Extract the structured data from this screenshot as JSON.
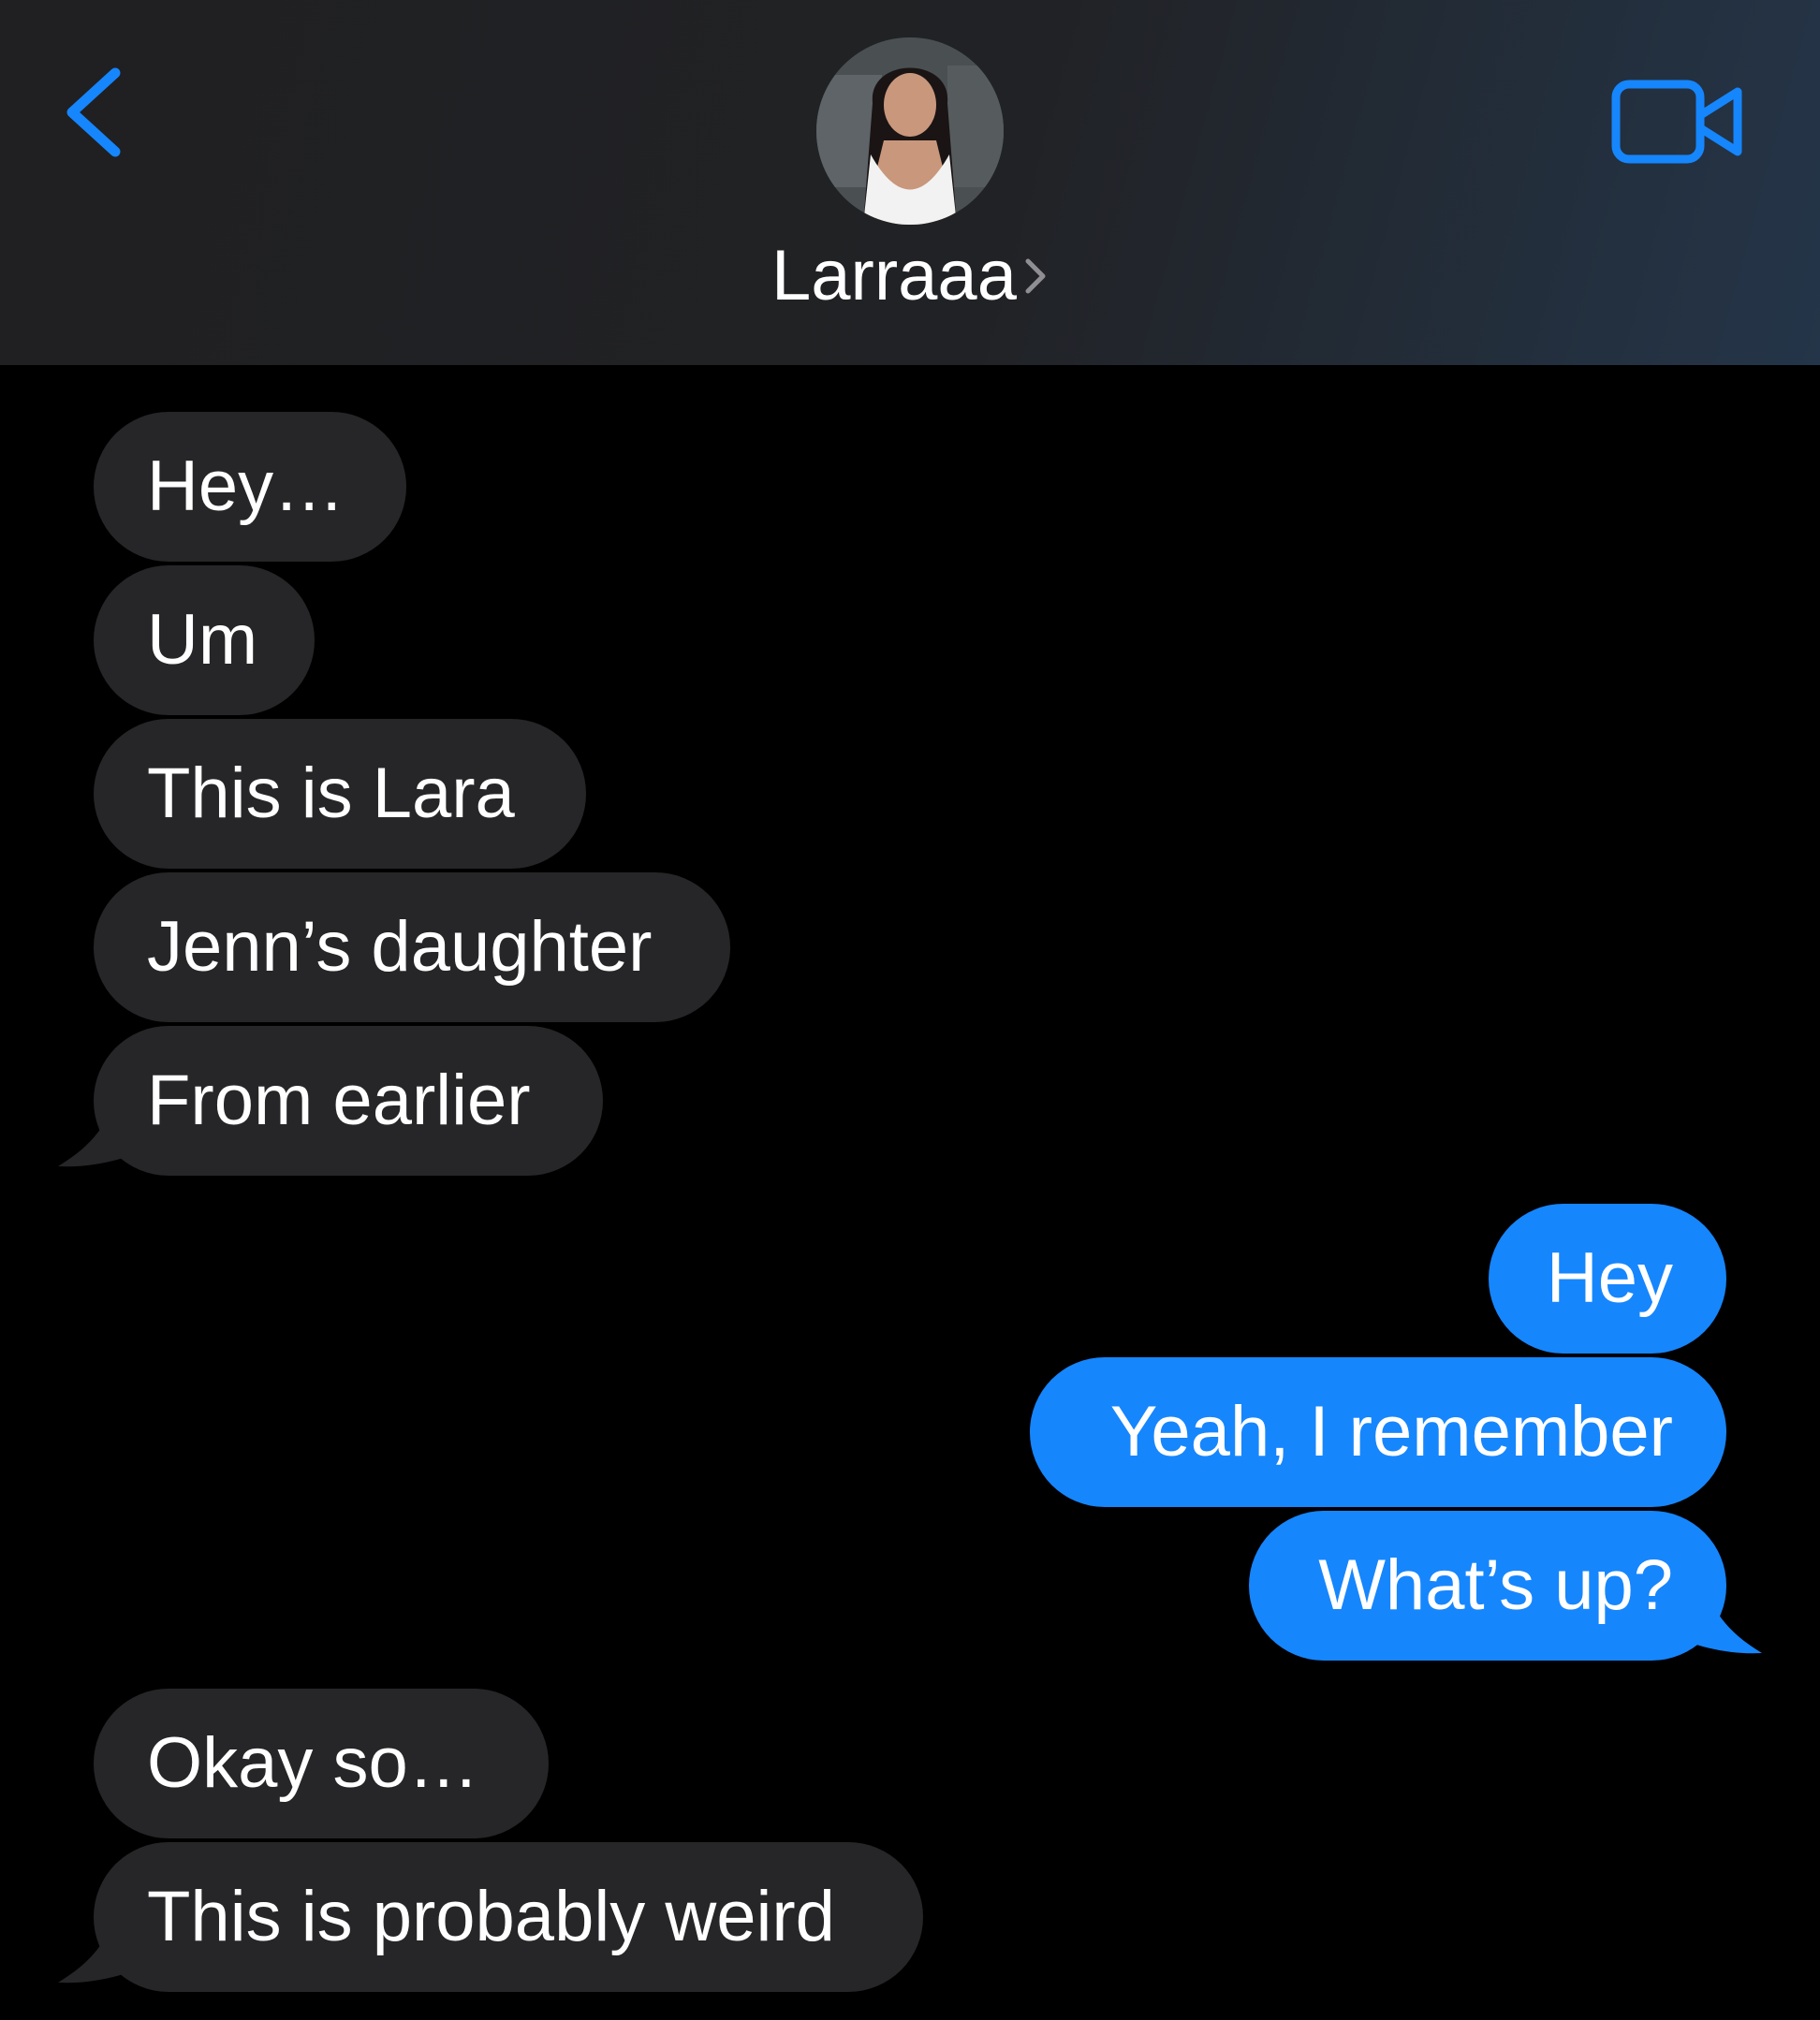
{
  "header": {
    "back_icon": "chevron-left-icon",
    "contact_name": "Larraaa",
    "video_icon": "video-camera-icon",
    "accent_color": "#1686fd"
  },
  "messages": [
    {
      "direction": "incoming",
      "text": "Hey…"
    },
    {
      "direction": "incoming",
      "text": "Um"
    },
    {
      "direction": "incoming",
      "text": "This is Lara"
    },
    {
      "direction": "incoming",
      "text": "Jenn’s daughter"
    },
    {
      "direction": "incoming",
      "text": "From earlier"
    },
    {
      "direction": "outgoing",
      "text": "Hey"
    },
    {
      "direction": "outgoing",
      "text": "Yeah, I remember"
    },
    {
      "direction": "outgoing",
      "text": "What’s up?"
    },
    {
      "direction": "incoming",
      "text": "Okay so…"
    },
    {
      "direction": "incoming",
      "text": "This is probably weird"
    }
  ],
  "colors": {
    "incoming_bubble": "#262628",
    "outgoing_bubble": "#1686fd",
    "background": "#000000"
  }
}
